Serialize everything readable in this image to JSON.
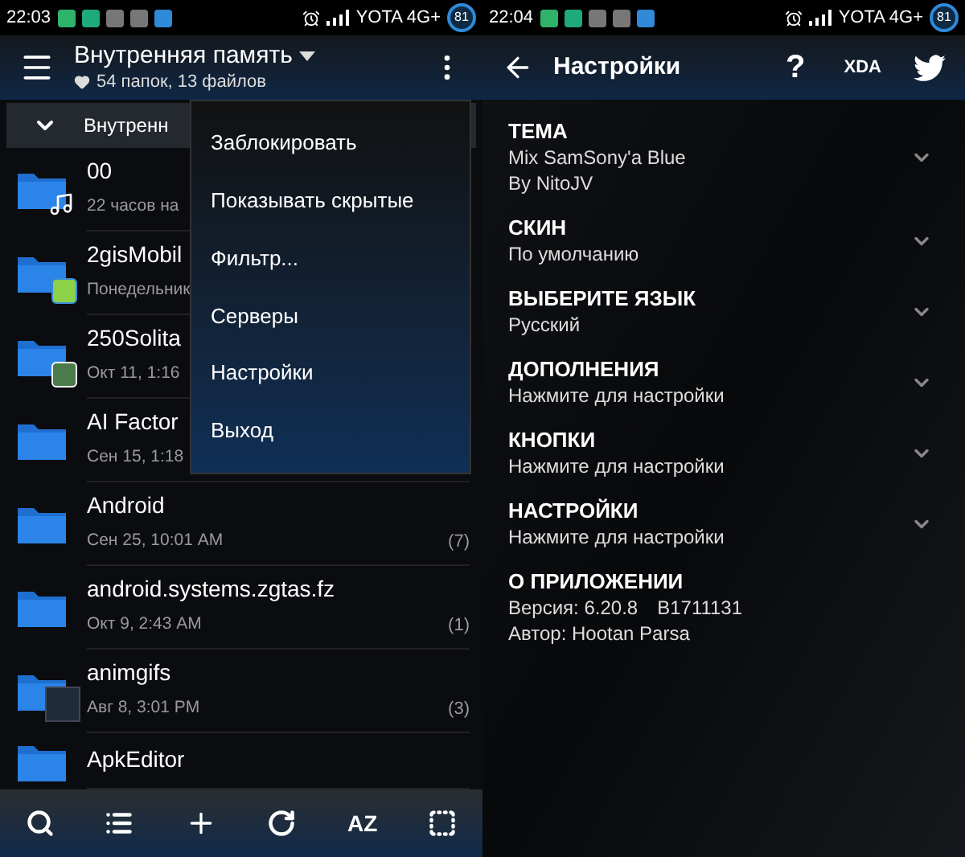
{
  "left": {
    "status_bar": {
      "time": "22:03",
      "carrier": "YOTA 4G+",
      "battery": "81"
    },
    "header": {
      "title": "Внутренняя память",
      "subtitle": "54 папок, 13 файлов"
    },
    "breadcrumb": "Внутренн",
    "files": [
      {
        "name": "00",
        "meta": "22 часов на",
        "kind": "music"
      },
      {
        "name": "2gisMobil",
        "meta": "Понедельник",
        "kind": "map"
      },
      {
        "name": "250Solita",
        "meta": "Окт 11, 1:16",
        "kind": "cards"
      },
      {
        "name": "AI Factor",
        "meta": "Сен 15, 1:18"
      },
      {
        "name": "Android",
        "meta": "Сен 25, 10:01 AM",
        "count": "(7)"
      },
      {
        "name": "android.systems.zgtas.fz",
        "meta": "Окт 9, 2:43 AM",
        "count": "(1)"
      },
      {
        "name": "animgifs",
        "meta": "Авг 8, 3:01 PM",
        "count": "(3)",
        "kind": "image"
      },
      {
        "name": "ApkEditor"
      }
    ],
    "menu": [
      "Заблокировать",
      "Показывать скрытые",
      "Фильтр...",
      "Серверы",
      "Настройки",
      "Выход"
    ],
    "toolbar": {
      "sort_label": "AZ"
    }
  },
  "right": {
    "status_bar": {
      "time": "22:04",
      "carrier": "YOTA 4G+",
      "battery": "81"
    },
    "header": {
      "title": "Настройки",
      "help": "?",
      "xda": "XDA"
    },
    "settings": [
      {
        "kind": "option",
        "title": "ТЕМА",
        "lines": [
          "Mix SamSony'a Blue",
          "By NitoJV"
        ]
      },
      {
        "kind": "option",
        "title": "СКИН",
        "lines": [
          "По умолчанию"
        ]
      },
      {
        "kind": "option",
        "title": "ВЫБЕРИТЕ ЯЗЫК",
        "lines": [
          "Русский"
        ]
      },
      {
        "kind": "option",
        "title": "ДОПОЛНЕНИЯ",
        "lines": [
          "Нажмите для настройки"
        ]
      },
      {
        "kind": "option",
        "title": "КНОПКИ",
        "lines": [
          "Нажмите для настройки"
        ]
      },
      {
        "kind": "option",
        "title": "НАСТРОЙКИ",
        "lines": [
          "Нажмите для настройки"
        ]
      },
      {
        "kind": "about",
        "title": "О ПРИЛОЖЕНИИ",
        "version": "Версия: 6.20.8",
        "build": "B1711131",
        "author": "Автор: Hootan Parsa"
      }
    ]
  }
}
